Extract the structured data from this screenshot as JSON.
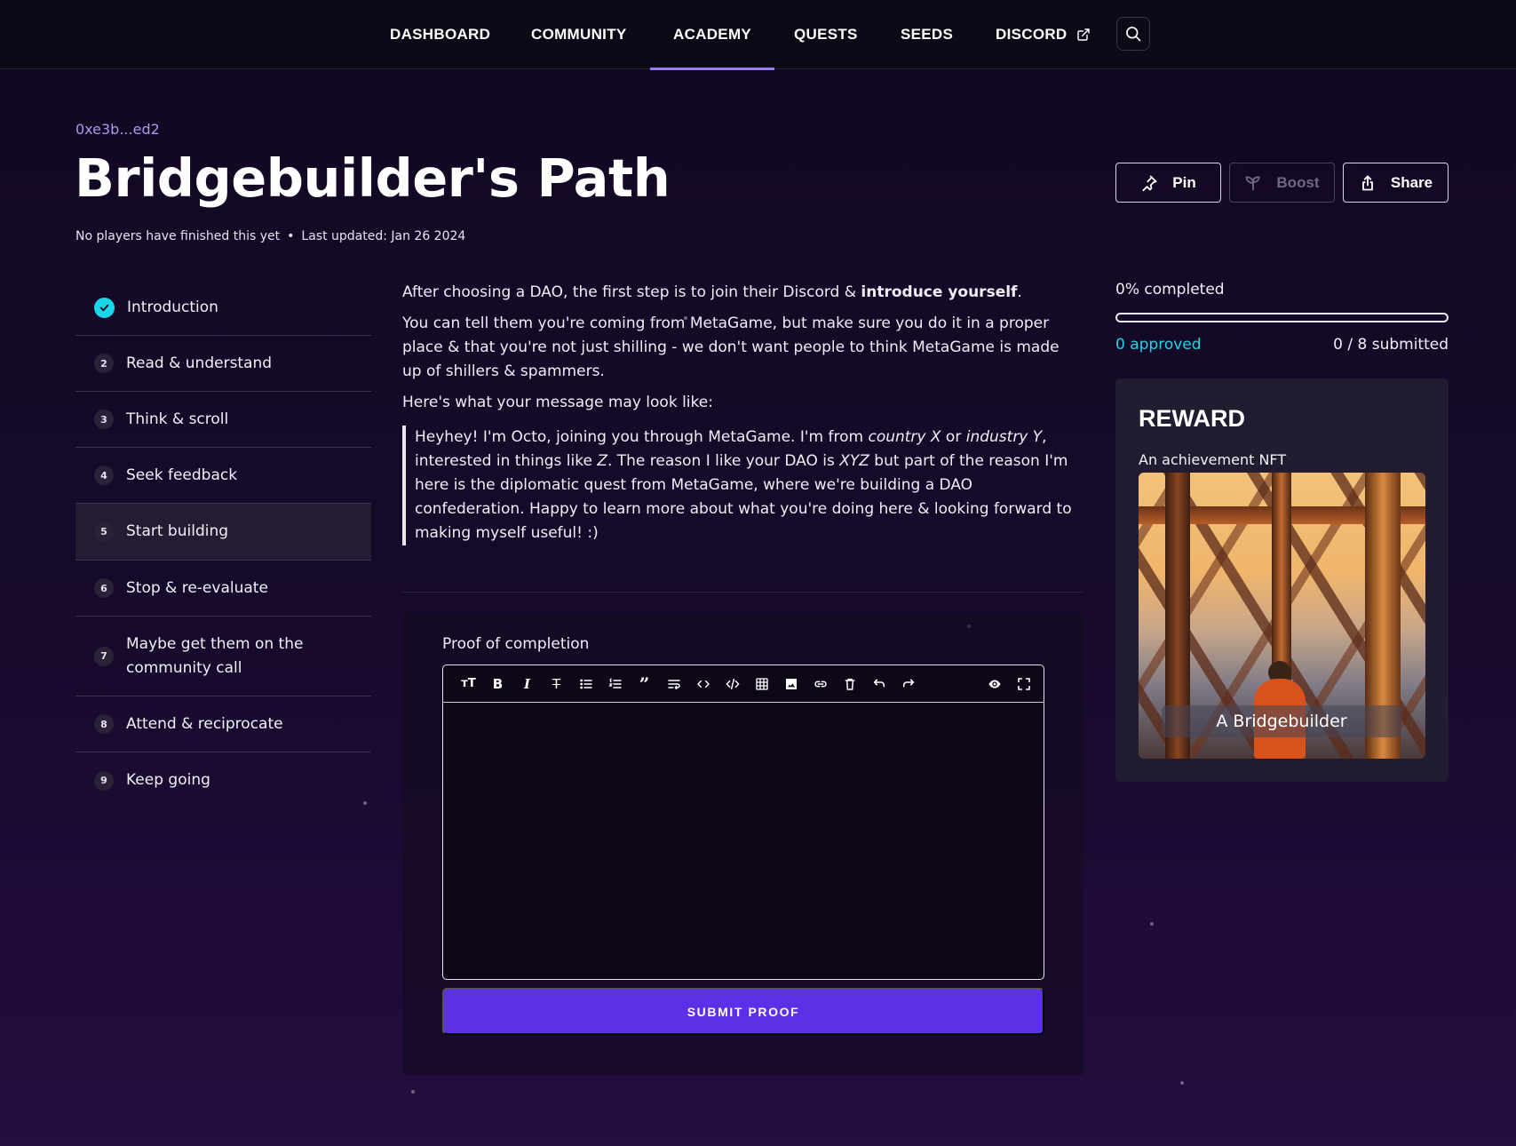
{
  "nav": {
    "items": [
      {
        "label": "DASHBOARD"
      },
      {
        "label": "COMMUNITY"
      },
      {
        "label": "ACADEMY"
      },
      {
        "label": "QUESTS"
      },
      {
        "label": "SEEDS"
      },
      {
        "label": "DISCORD"
      }
    ],
    "active": "ACADEMY"
  },
  "header": {
    "address": "0xe3b...ed2",
    "title": "Bridgebuilder's Path",
    "finished": "No players have finished this yet",
    "updated": "Last updated: Jan 26 2024"
  },
  "actions": {
    "pin": "Pin",
    "boost": "Boost",
    "share": "Share"
  },
  "steps": [
    {
      "num": "1",
      "label": "Introduction",
      "completed": true
    },
    {
      "num": "2",
      "label": "Read & understand"
    },
    {
      "num": "3",
      "label": "Think & scroll"
    },
    {
      "num": "4",
      "label": "Seek feedback"
    },
    {
      "num": "5",
      "label": "Start building",
      "active": true
    },
    {
      "num": "6",
      "label": "Stop & re-evaluate"
    },
    {
      "num": "7",
      "label": "Maybe get them on the community call"
    },
    {
      "num": "8",
      "label": "Attend & reciprocate"
    },
    {
      "num": "9",
      "label": "Keep going"
    }
  ],
  "content": {
    "p1_start": "After choosing a DAO, the first step is to join their Discord & ",
    "p1_bold": "introduce yourself",
    "p1_end": ".",
    "p2": "You can tell them you're coming from MetaGame, but make sure you do it in a proper place & that you're not just shilling - we don't want people to think MetaGame is made up of shillers & spammers.",
    "p3": "Here's what your message may look like:",
    "quote": {
      "a": "Heyhey! I'm Octo, joining you through MetaGame. I'm from ",
      "b": "country X",
      "c": " or ",
      "d": "industry Y",
      "e": ", interested in things like ",
      "f": "Z",
      "g": ". The reason I like your DAO is ",
      "h": "XYZ",
      "i": " but part of the reason I'm here is the diplomatic quest from MetaGame, where we're building a DAO confederation. Happy to learn more about what you're doing here & looking forward to making myself useful! :)"
    }
  },
  "proof": {
    "label": "Proof of completion",
    "editor_value": "",
    "submit": "SUBMIT PROOF"
  },
  "progress": {
    "percent_label": "0% completed",
    "percent": 0,
    "approved": "0 approved",
    "submitted": "0 / 8 submitted"
  },
  "reward": {
    "title": "REWARD",
    "subtitle": "An achievement NFT",
    "nft_caption": "A Bridgebuilder"
  },
  "colors": {
    "accent": "#5b30e6",
    "cyan": "#19d7e8",
    "nav_underline": "#9b7cf0",
    "address": "#a79bf2"
  }
}
